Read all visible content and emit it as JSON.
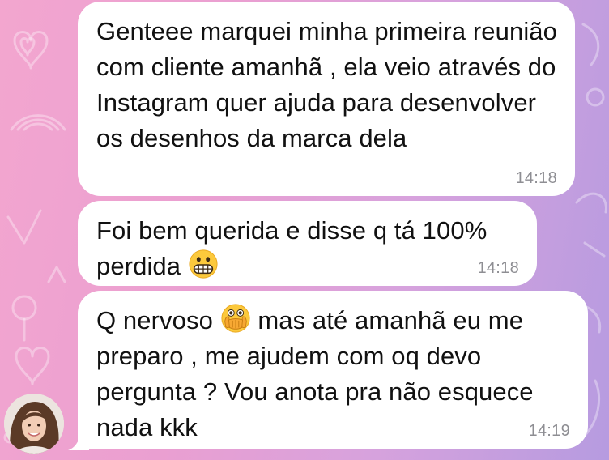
{
  "messages": [
    {
      "text": "Genteee marquei minha primeira reunião com cliente amanhã , ela veio através do Instagram quer ajuda para desenvolver os desenhos da marca dela",
      "time": "14:18"
    },
    {
      "text_before": "Foi bem querida e disse q tá 100% perdida",
      "emoji": "grimacing-face-emoji",
      "time": "14:18"
    },
    {
      "text_before": "Q nervoso",
      "emoji": "face-with-open-eyes-and-hand-over-mouth-emoji",
      "text_after": "mas até amanhã eu me preparo , me ajudem com oq devo pergunta ? Vou anota pra não esquece nada kkk",
      "time": "14:19"
    }
  ],
  "sender": {
    "avatar": "sender-avatar-photo"
  },
  "colors": {
    "bubble": "#ffffff",
    "text": "#111111",
    "timestamp": "#8e8e93",
    "wallpaper_left": "#f3a6cf",
    "wallpaper_right": "#b69be0"
  }
}
